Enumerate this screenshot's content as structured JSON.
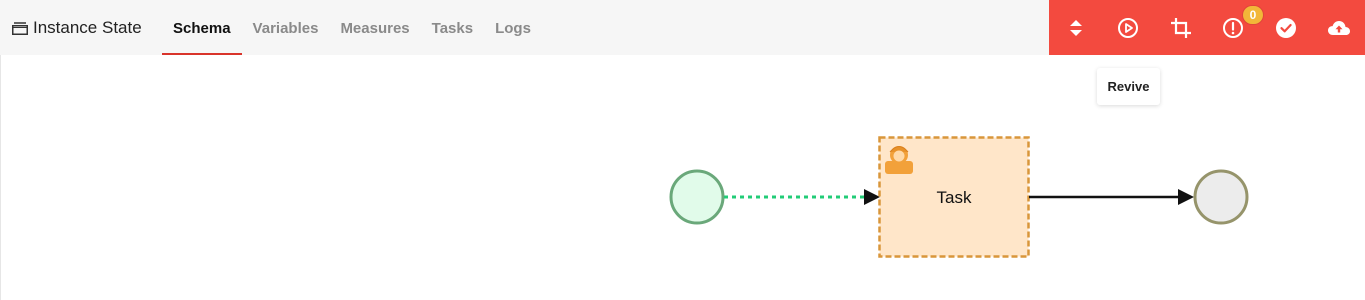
{
  "header": {
    "title": "Instance State",
    "title_icon": "window-stack-icon",
    "tabs": [
      {
        "label": "Schema",
        "active": true
      },
      {
        "label": "Variables",
        "active": false
      },
      {
        "label": "Measures",
        "active": false
      },
      {
        "label": "Tasks",
        "active": false
      },
      {
        "label": "Logs",
        "active": false
      }
    ]
  },
  "toolbar": {
    "background": "#f34a3f",
    "buttons": [
      {
        "icon": "sort-icon"
      },
      {
        "icon": "play-circle-icon"
      },
      {
        "icon": "crop-icon"
      },
      {
        "icon": "alert-circle-icon",
        "badge": "0"
      },
      {
        "icon": "check-circle-icon"
      },
      {
        "icon": "cloud-upload-icon"
      }
    ],
    "tooltip": "Revive"
  },
  "diagram": {
    "task": {
      "label": "Task",
      "icon": "user-task-icon",
      "fill": "#ffe6c9",
      "border": "#d9963a"
    },
    "start_event": {
      "fill": "#e1fbea",
      "border": "#6aa87a"
    },
    "end_event": {
      "fill": "#ececec",
      "border": "#96946b"
    },
    "incoming_flow_color": "#22cc77",
    "outgoing_flow_color": "#111111"
  }
}
